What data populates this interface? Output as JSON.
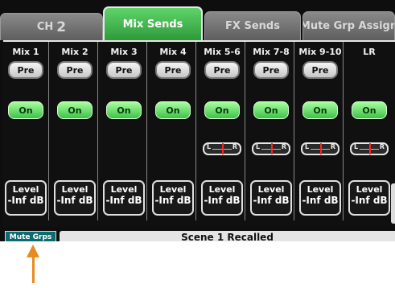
{
  "tabs": {
    "ch_prefix": "CH",
    "ch_number": "2",
    "mix_sends": "Mix Sends",
    "fx_sends": "FX Sends",
    "mute_grp_assign": "Mute Grp Assign"
  },
  "strips": [
    {
      "name": "Mix 1",
      "pre": "Pre",
      "on": "On",
      "level_label": "Level",
      "level_value": "-Inf dB",
      "pan": false
    },
    {
      "name": "Mix 2",
      "pre": "Pre",
      "on": "On",
      "level_label": "Level",
      "level_value": "-Inf dB",
      "pan": false
    },
    {
      "name": "Mix 3",
      "pre": "Pre",
      "on": "On",
      "level_label": "Level",
      "level_value": "-Inf dB",
      "pan": false
    },
    {
      "name": "Mix 4",
      "pre": "Pre",
      "on": "On",
      "level_label": "Level",
      "level_value": "-Inf dB",
      "pan": false
    },
    {
      "name": "Mix 5-6",
      "pre": "Pre",
      "on": "On",
      "level_label": "Level",
      "level_value": "-Inf dB",
      "pan": true
    },
    {
      "name": "Mix 7-8",
      "pre": "Pre",
      "on": "On",
      "level_label": "Level",
      "level_value": "-Inf dB",
      "pan": true
    },
    {
      "name": "Mix 9-10",
      "pre": "Pre",
      "on": "On",
      "level_label": "Level",
      "level_value": "-Inf dB",
      "pan": true
    },
    {
      "name": "LR",
      "pre": "",
      "on": "On",
      "level_label": "Level",
      "level_value": "-Inf dB",
      "pan": true
    }
  ],
  "pan_labels": {
    "left": "L",
    "right": "R"
  },
  "bottom": {
    "mute_grps": "Mute Grps",
    "status": "Scene 1 Recalled"
  },
  "colors": {
    "active_tab": "#3fb54a",
    "on_button": "#5fd65a",
    "mute_button": "#0d6a6e",
    "arrow": "#e98a1e",
    "pan_marker": "#ff2222"
  }
}
